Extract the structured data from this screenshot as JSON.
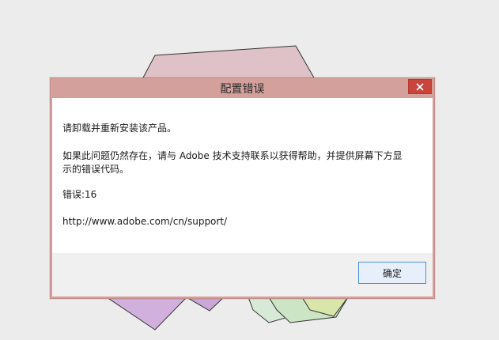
{
  "dialog": {
    "title": "配置错误",
    "close_glyph": "✕",
    "message_line1": "请卸载并重新安装该产品。",
    "message_line2": "如果此问题仍然存在，请与 Adobe 技术支持联系以获得帮助，并提供屏幕下方显\n示的错误代码。",
    "error_code": "错误:16",
    "support_url": "http://www.adobe.com/cn/support/",
    "ok_label": "确定"
  },
  "colors": {
    "titlebar": "#d4a09c",
    "close_button": "#c9443a",
    "ok_border": "#4a90d9",
    "background": "#ececec"
  },
  "icons": {
    "close": "close-icon"
  }
}
